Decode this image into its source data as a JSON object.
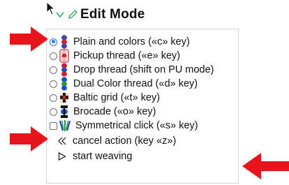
{
  "header": {
    "title": "Edit Mode"
  },
  "modes": [
    {
      "label": "Plain and colors («c» key)",
      "checked": true,
      "icon": "plain-colors-thread-icon"
    },
    {
      "label": "Pickup thread («e» key)",
      "checked": false,
      "icon": "pickup-thread-icon"
    },
    {
      "label": "Drop thread (shift on PU mode)",
      "checked": false,
      "icon": "drop-thread-icon"
    },
    {
      "label": "Dual Color thread («d» key)",
      "checked": false,
      "icon": "dual-color-thread-icon"
    },
    {
      "label": "Baltic grid («t» key)",
      "checked": false,
      "icon": "baltic-grid-icon"
    },
    {
      "label": "Brocade («o» key)",
      "checked": false,
      "icon": "brocade-icon"
    }
  ],
  "symmetric": {
    "label": "Symmetrical click («s» key)",
    "checked": false
  },
  "actions": {
    "cancel": "cancel action (key «z»)",
    "start": "start weaving"
  },
  "colors": {
    "accent": "#2d7ff4",
    "annotation_arrow": "#e8141b",
    "thread_blue": "#1f4fc8",
    "thread_red": "#d0202a",
    "thread_green": "#2a9b3a"
  }
}
